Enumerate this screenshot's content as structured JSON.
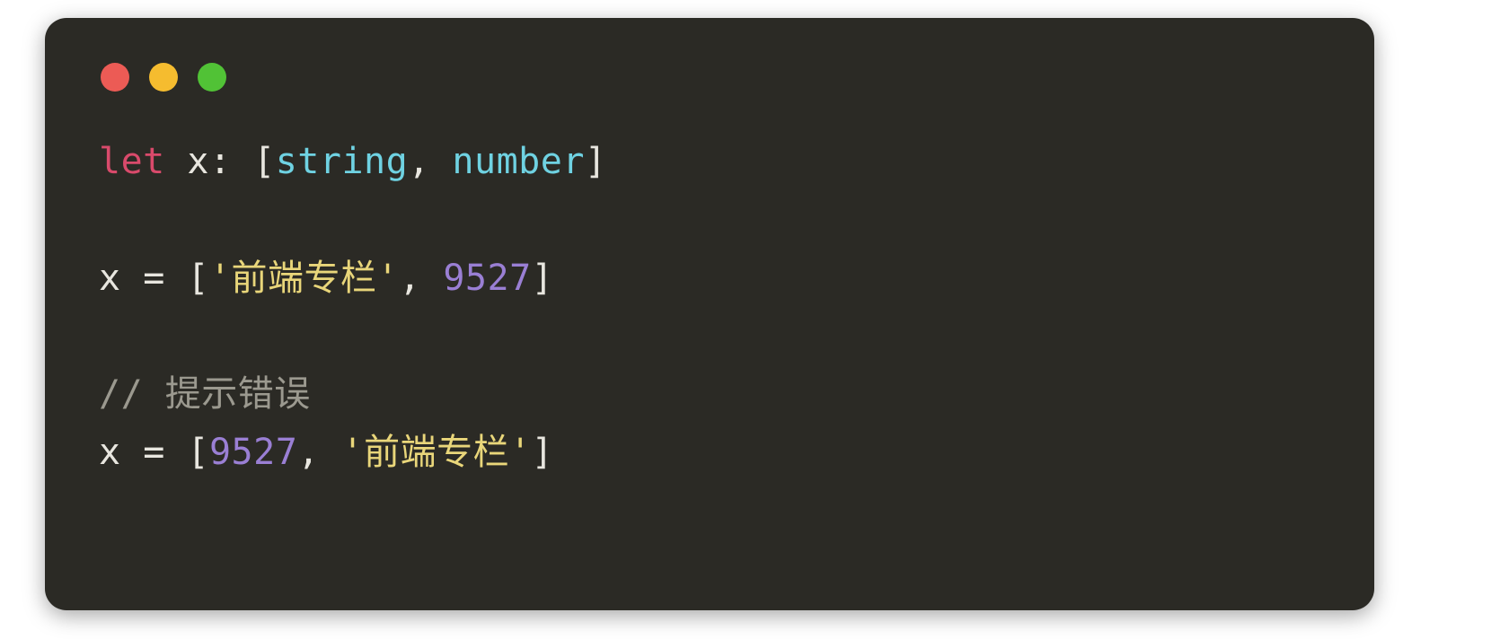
{
  "code": {
    "line1": {
      "kw_let": "let",
      "var": "x",
      "colon": ":",
      "lbr": "[",
      "type1": "string",
      "comma": ",",
      "type2": "number",
      "rbr": "]"
    },
    "line3": {
      "lhs": "x",
      "eq": "=",
      "lbr": "[",
      "str": "'前端专栏'",
      "comma": ",",
      "num": "9527",
      "rbr": "]"
    },
    "line5_comment": "// 提示错误",
    "line6": {
      "lhs": "x",
      "eq": "=",
      "lbr": "[",
      "num": "9527",
      "comma": ",",
      "str": "'前端专栏'",
      "rbr": "]"
    }
  }
}
